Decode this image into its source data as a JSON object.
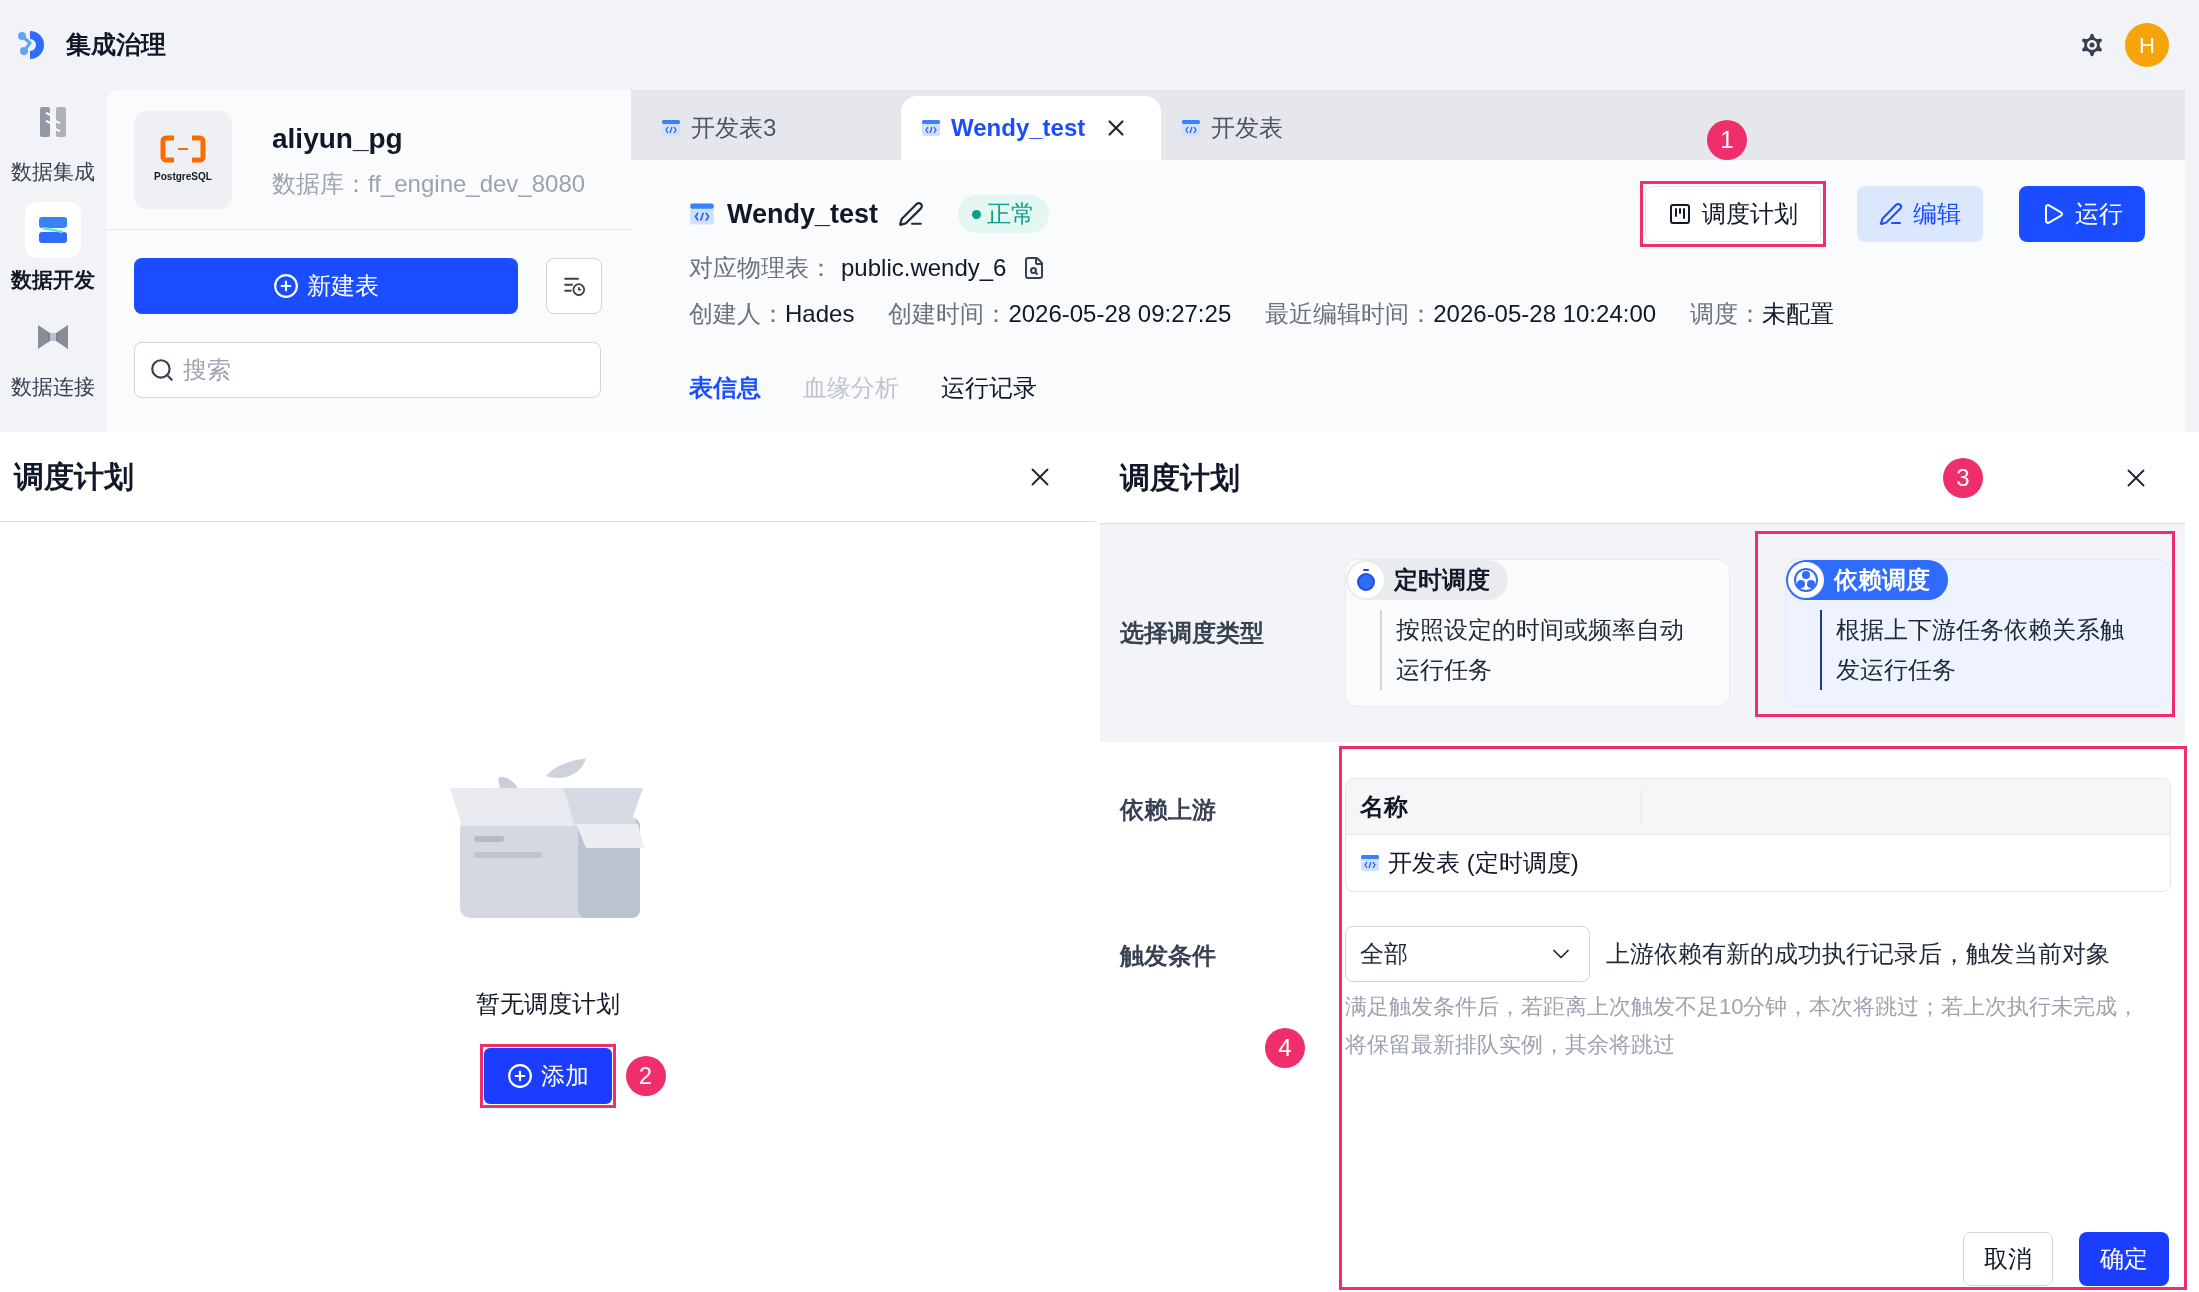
{
  "app": {
    "title": "集成治理",
    "avatar": "H"
  },
  "nav": [
    {
      "label": "数据集成",
      "selected": false
    },
    {
      "label": "数据开发",
      "selected": true
    },
    {
      "label": "数据连接",
      "selected": false
    }
  ],
  "datasource": {
    "name": "aliyun_pg",
    "logo_text": "PostgreSQL",
    "database": "数据库：ff_engine_dev_8080"
  },
  "new_table_button": "新建表",
  "search": {
    "placeholder": "搜索"
  },
  "tabs": [
    {
      "label": "开发表3",
      "selected": false,
      "closable": false
    },
    {
      "label": "Wendy_test",
      "selected": true,
      "closable": true
    },
    {
      "label": "开发表",
      "selected": false,
      "closable": false
    }
  ],
  "detail": {
    "name": "Wendy_test",
    "status": "正常",
    "physical_label": "对应物理表：",
    "physical_value": "public.wendy_6",
    "meta": [
      {
        "label": "创建人：",
        "value": "Hades"
      },
      {
        "label": "创建时间：",
        "value": "2026-05-28 09:27:25"
      },
      {
        "label": "最近编辑时间：",
        "value": "2026-05-28 10:24:00"
      },
      {
        "label": "调度：",
        "value": "未配置"
      }
    ],
    "actions": [
      {
        "label": "调度计划",
        "kind": "outline"
      },
      {
        "label": "编辑",
        "kind": "soft"
      },
      {
        "label": "运行",
        "kind": "primary"
      }
    ],
    "subtabs": [
      {
        "label": "表信息",
        "selected": true,
        "disabled": false
      },
      {
        "label": "血缘分析",
        "selected": false,
        "disabled": true
      },
      {
        "label": "运行记录",
        "selected": false,
        "disabled": false
      }
    ]
  },
  "empty_dialog": {
    "title": "调度计划",
    "message": "暂无调度计划",
    "add_button": "添加"
  },
  "schedule_dialog": {
    "title": "调度计划",
    "type_label": "选择调度类型",
    "types": [
      {
        "title": "定时调度",
        "description": "按照设定的时间或频率自动运行任务",
        "selected": false
      },
      {
        "title": "依赖调度",
        "description": "根据上下游任务依赖关系触发运行任务",
        "selected": true
      }
    ],
    "upstream_label": "依赖上游",
    "table_column": "名称",
    "upstream_rows": [
      "开发表 (定时调度)"
    ],
    "trigger_label": "触发条件",
    "trigger_value": "全部",
    "trigger_description": "上游依赖有新的成功执行记录后，触发当前对象",
    "hint": "满足触发条件后，若距离上次触发不足10分钟，本次将跳过；若上次执行未完成，将保留最新排队实例，其余将跳过",
    "cancel": "取消",
    "ok": "确定"
  },
  "annotations": [
    "1",
    "2",
    "3",
    "4"
  ]
}
